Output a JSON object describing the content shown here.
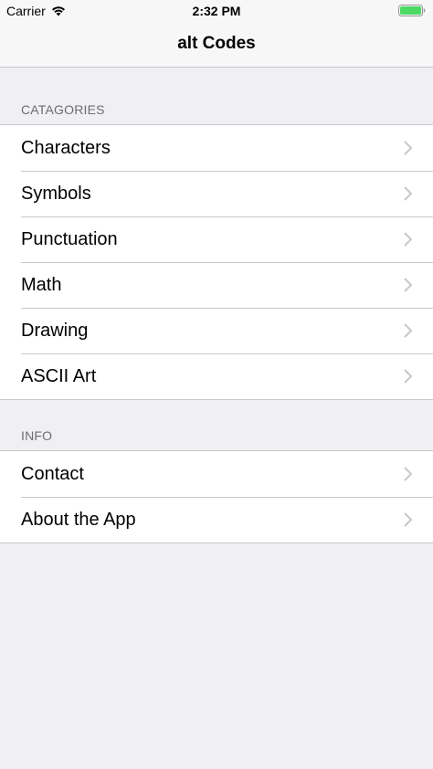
{
  "status_bar": {
    "carrier": "Carrier",
    "time": "2:32 PM",
    "wifi_icon": "wifi-icon",
    "battery_icon": "battery-icon",
    "battery_color": "#4cd964"
  },
  "nav": {
    "title": "alt Codes"
  },
  "sections": {
    "categories": {
      "header": "CATAGORIES",
      "items": [
        {
          "label": "Characters"
        },
        {
          "label": "Symbols"
        },
        {
          "label": "Punctuation"
        },
        {
          "label": "Math"
        },
        {
          "label": "Drawing"
        },
        {
          "label": "ASCII Art"
        }
      ]
    },
    "info": {
      "header": "INFO",
      "items": [
        {
          "label": "Contact"
        },
        {
          "label": "About the App"
        }
      ]
    }
  },
  "colors": {
    "background": "#efeff4",
    "separator": "#c8c7cc",
    "header_text": "#6d6d72",
    "chevron": "#c7c7cc"
  }
}
